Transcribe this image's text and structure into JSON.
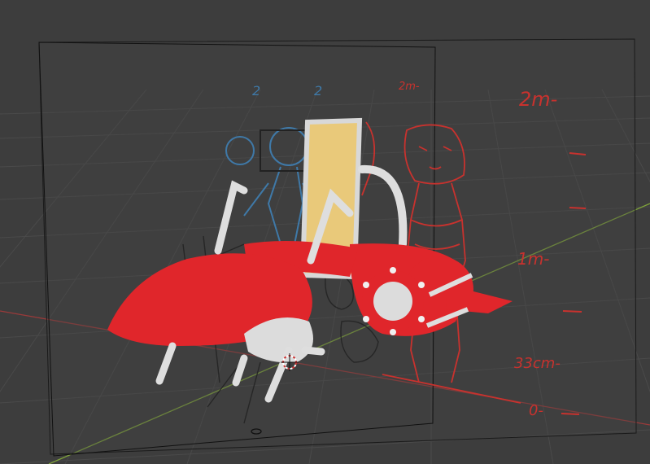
{
  "viewport": {
    "background": "#3d3d3d",
    "grid_color": "#4a4a4a",
    "x_axis_color": "#9a3a3a",
    "y_axis_color": "#7fa33a"
  },
  "colors": {
    "aircraft_red": "#e0262b",
    "aircraft_white": "#dcdcdc",
    "seat_back": "#e9c97a",
    "sketch_red": "#c8322e",
    "sketch_blue": "#3f79a8",
    "sketch_dark": "#222222"
  },
  "scale_labels": {
    "m2_large": "2m-",
    "m2_small": "2m-",
    "m1": "1m-",
    "cm33": "33cm-",
    "zero": "0-"
  },
  "blue_labels": {
    "left": "2",
    "right": "2"
  },
  "icons": {
    "cursor": "3d-cursor-icon",
    "origin": "object-origin-icon"
  }
}
